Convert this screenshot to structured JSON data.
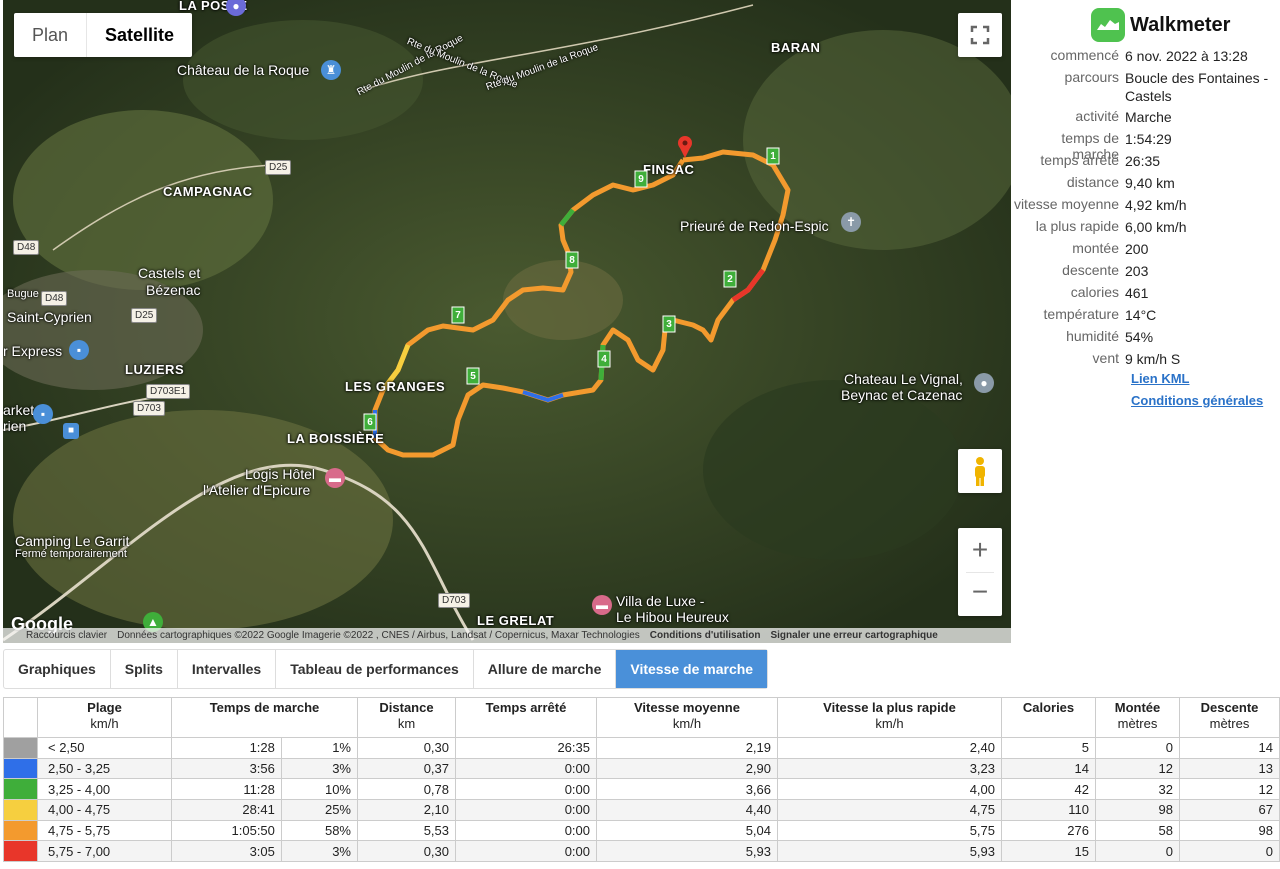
{
  "map": {
    "type_buttons": [
      "Plan",
      "Satellite"
    ],
    "active_type": "Satellite",
    "labels": {
      "la_poste": "LA POSTE",
      "chateau_roque": "Château de la Roque",
      "rte_moulin_1": "Rte du Moulin de la Roque",
      "rte_moulin_2": "Rte du Moulin de la Roque",
      "rte_moulin_3": "Rte du Moulin de la Roque",
      "baran": "BARAN",
      "finsac": "FINSAC",
      "campagnac": "CAMPAGNAC",
      "prieure": "Prieuré de Redon-Espic",
      "castels_1": "Castels et",
      "castels_2": "Bézenac",
      "bugue": "Bugue",
      "saint_cyprien": "Saint-Cyprien",
      "express": "r Express",
      "luziers": "LUZIERS",
      "les_granges": "LES GRANGES",
      "market_1": "arket",
      "market_2": "rien",
      "la_boissiere": "LA BOISSIÈRE",
      "logis_1": "Logis Hôtel",
      "logis_2": "l'Atelier d'Epicure",
      "chateau_vignal_1": "Chateau Le Vignal,",
      "chateau_vignal_2": "Beynac et Cazenac",
      "camping_1": "Camping Le Garrit",
      "camping_2": "Fermé temporairement",
      "villa_1": "Villa de Luxe -",
      "villa_2": "Le Hibou Heureux",
      "le_grelat": "LE GRELAT",
      "google": "Google"
    },
    "roads": [
      "D25",
      "D48",
      "D48",
      "D25",
      "D703E1",
      "D703",
      "D703"
    ],
    "markers": [
      "1",
      "2",
      "3",
      "4",
      "5",
      "6",
      "7",
      "8",
      "9"
    ],
    "attribution": [
      "Raccourcis clavier",
      "Données cartographiques ©2022 Google Imagerie ©2022 , CNES / Airbus, Landsat / Copernicus, Maxar Technologies",
      "Conditions d'utilisation",
      "Signaler une erreur cartographique"
    ]
  },
  "info": {
    "app_name": "Walkmeter",
    "rows": [
      {
        "key": "commencé",
        "value": "6 nov. 2022 à 13:28"
      },
      {
        "key": "parcours",
        "value": "Boucle des Fontaines - Castels"
      },
      {
        "key": "activité",
        "value": "Marche"
      },
      {
        "key": "temps de marche",
        "value": "1:54:29"
      },
      {
        "key": "temps arrêté",
        "value": "26:35"
      },
      {
        "key": "distance",
        "value": "9,40 km"
      },
      {
        "key": "vitesse moyenne",
        "value": "4,92 km/h"
      },
      {
        "key": "la plus rapide",
        "value": "6,00 km/h"
      },
      {
        "key": "montée",
        "value": "200"
      },
      {
        "key": "descente",
        "value": "203"
      },
      {
        "key": "calories",
        "value": "461"
      },
      {
        "key": "température",
        "value": "14°C"
      },
      {
        "key": "humidité",
        "value": "54%"
      },
      {
        "key": "vent",
        "value": "9 km/h S"
      }
    ],
    "link_kml": "Lien KML",
    "link_terms": "Conditions générales"
  },
  "tabs": [
    "Graphiques",
    "Splits",
    "Intervalles",
    "Tableau de performances",
    "Allure de marche",
    "Vitesse de marche"
  ],
  "active_tab": "Vitesse de marche",
  "table": {
    "headers": [
      {
        "title": "Plage",
        "unit": "km/h"
      },
      {
        "title": "Temps de marche",
        "unit": ""
      },
      {
        "title": "Distance",
        "unit": "km"
      },
      {
        "title": "Temps arrêté",
        "unit": ""
      },
      {
        "title": "Vitesse moyenne",
        "unit": "km/h"
      },
      {
        "title": "Vitesse la plus rapide",
        "unit": "km/h"
      },
      {
        "title": "Calories",
        "unit": ""
      },
      {
        "title": "Montée",
        "unit": "mètres"
      },
      {
        "title": "Descente",
        "unit": "mètres"
      }
    ],
    "rows": [
      {
        "color": "#a0a0a0",
        "plage": "< 2,50",
        "temps": "1:28",
        "pct": "1%",
        "distance": "0,30",
        "arrete": "26:35",
        "moyenne": "2,19",
        "rapide": "2,40",
        "calories": "5",
        "montee": "0",
        "descente": "14"
      },
      {
        "color": "#2f6fe8",
        "plage": "2,50 - 3,25",
        "temps": "3:56",
        "pct": "3%",
        "distance": "0,37",
        "arrete": "0:00",
        "moyenne": "2,90",
        "rapide": "3,23",
        "calories": "14",
        "montee": "12",
        "descente": "13"
      },
      {
        "color": "#3fae3a",
        "plage": "3,25 - 4,00",
        "temps": "11:28",
        "pct": "10%",
        "distance": "0,78",
        "arrete": "0:00",
        "moyenne": "3,66",
        "rapide": "4,00",
        "calories": "42",
        "montee": "32",
        "descente": "12"
      },
      {
        "color": "#f6cf3f",
        "plage": "4,00 - 4,75",
        "temps": "28:41",
        "pct": "25%",
        "distance": "2,10",
        "arrete": "0:00",
        "moyenne": "4,40",
        "rapide": "4,75",
        "calories": "110",
        "montee": "98",
        "descente": "67"
      },
      {
        "color": "#f39a2e",
        "plage": "4,75 - 5,75",
        "temps": "1:05:50",
        "pct": "58%",
        "distance": "5,53",
        "arrete": "0:00",
        "moyenne": "5,04",
        "rapide": "5,75",
        "calories": "276",
        "montee": "58",
        "descente": "98"
      },
      {
        "color": "#e8362a",
        "plage": "5,75 - 7,00",
        "temps": "3:05",
        "pct": "3%",
        "distance": "0,30",
        "arrete": "0:00",
        "moyenne": "5,93",
        "rapide": "5,93",
        "calories": "15",
        "montee": "0",
        "descente": "0"
      }
    ]
  }
}
